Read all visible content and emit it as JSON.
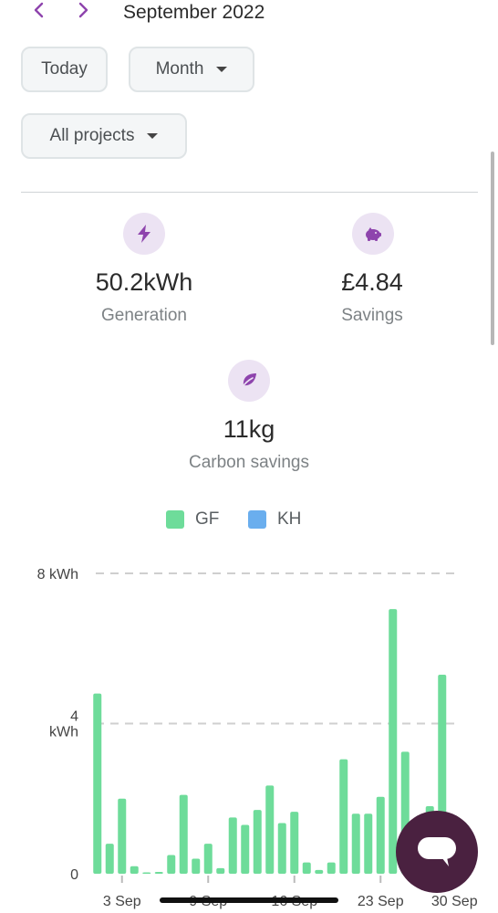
{
  "header": {
    "title": "September 2022",
    "prev_icon": "chevron-left-icon",
    "next_icon": "chevron-right-icon",
    "accent_color": "#8e44ad"
  },
  "controls": {
    "today_label": "Today",
    "range_label": "Month",
    "projects_label": "All projects"
  },
  "stats": {
    "generation": {
      "value": "50.2kWh",
      "label": "Generation",
      "icon": "lightning-icon"
    },
    "savings": {
      "value": "£4.84",
      "label": "Savings",
      "icon": "piggy-bank-icon"
    },
    "carbon": {
      "value": "11kg",
      "label": "Carbon savings",
      "icon": "leaf-icon"
    }
  },
  "legend": [
    {
      "name": "GF",
      "color": "#6edc9a"
    },
    {
      "name": "KH",
      "color": "#6aaeee"
    }
  ],
  "chart_data": {
    "type": "bar",
    "y_tick_labels": [
      "8 kWh",
      "4 kWh",
      "0"
    ],
    "ylim": [
      0,
      8
    ],
    "grid": true,
    "legend_position": "top",
    "x_tick_labels": [
      "3 Sep",
      "9 Sep",
      "16 Sep",
      "23 Sep",
      "30 Sep"
    ],
    "x": [
      1,
      2,
      3,
      4,
      5,
      6,
      7,
      8,
      9,
      10,
      11,
      12,
      13,
      14,
      15,
      16,
      17,
      18,
      19,
      20,
      21,
      22,
      23,
      24,
      25,
      26,
      27,
      28,
      29,
      30
    ],
    "series": [
      {
        "name": "GF",
        "color": "#6edc9a",
        "values": [
          4.8,
          0.8,
          2.0,
          0.2,
          0.0,
          0.05,
          0.5,
          2.1,
          0.4,
          0.8,
          0.15,
          1.5,
          1.3,
          1.7,
          2.35,
          1.35,
          1.65,
          0.3,
          0.1,
          0.3,
          3.05,
          1.6,
          1.6,
          2.05,
          7.05,
          3.25,
          0.9,
          1.8,
          5.3,
          0.6
        ]
      }
    ]
  },
  "chat": {
    "icon": "chat-bubble-icon"
  }
}
